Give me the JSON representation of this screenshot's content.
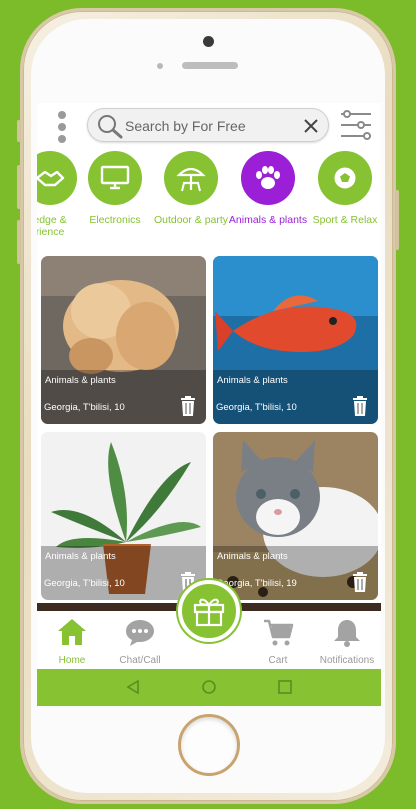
{
  "search": {
    "placeholder": "Search by For Free"
  },
  "categories": [
    {
      "label": "Knowledge & Experience",
      "label_visible": "edge &\nrience",
      "icon": "handshake-icon"
    },
    {
      "label": "Electronics",
      "icon": "monitor-icon"
    },
    {
      "label": "Outdoor & party",
      "icon": "umbrella-table-icon"
    },
    {
      "label": "Animals & plants",
      "icon": "paw-icon",
      "active": true
    },
    {
      "label": "Sport & Relax",
      "icon": "soccer-ball-icon"
    }
  ],
  "listings": [
    {
      "category": "Animals & plants",
      "location": "Georgia, T'bilisi, 10",
      "image": "dog-photo"
    },
    {
      "category": "Animals & plants",
      "location": "Georgia, T'bilisi, 10",
      "image": "fish-photo"
    },
    {
      "category": "Animals & plants",
      "location": "Georgia, T'bilisi, 10",
      "image": "plant-photo"
    },
    {
      "category": "Animals & plants",
      "location": "Georgia, T'bilisi, 19",
      "image": "kitten-photo"
    }
  ],
  "nav": {
    "home": "Home",
    "chat": "Chat/Call",
    "cart": "Cart",
    "notifications": "Notifications"
  },
  "colors": {
    "brand_green": "#86c232",
    "active_purple": "#9a1fd6",
    "background_green": "#7cbb2a"
  }
}
